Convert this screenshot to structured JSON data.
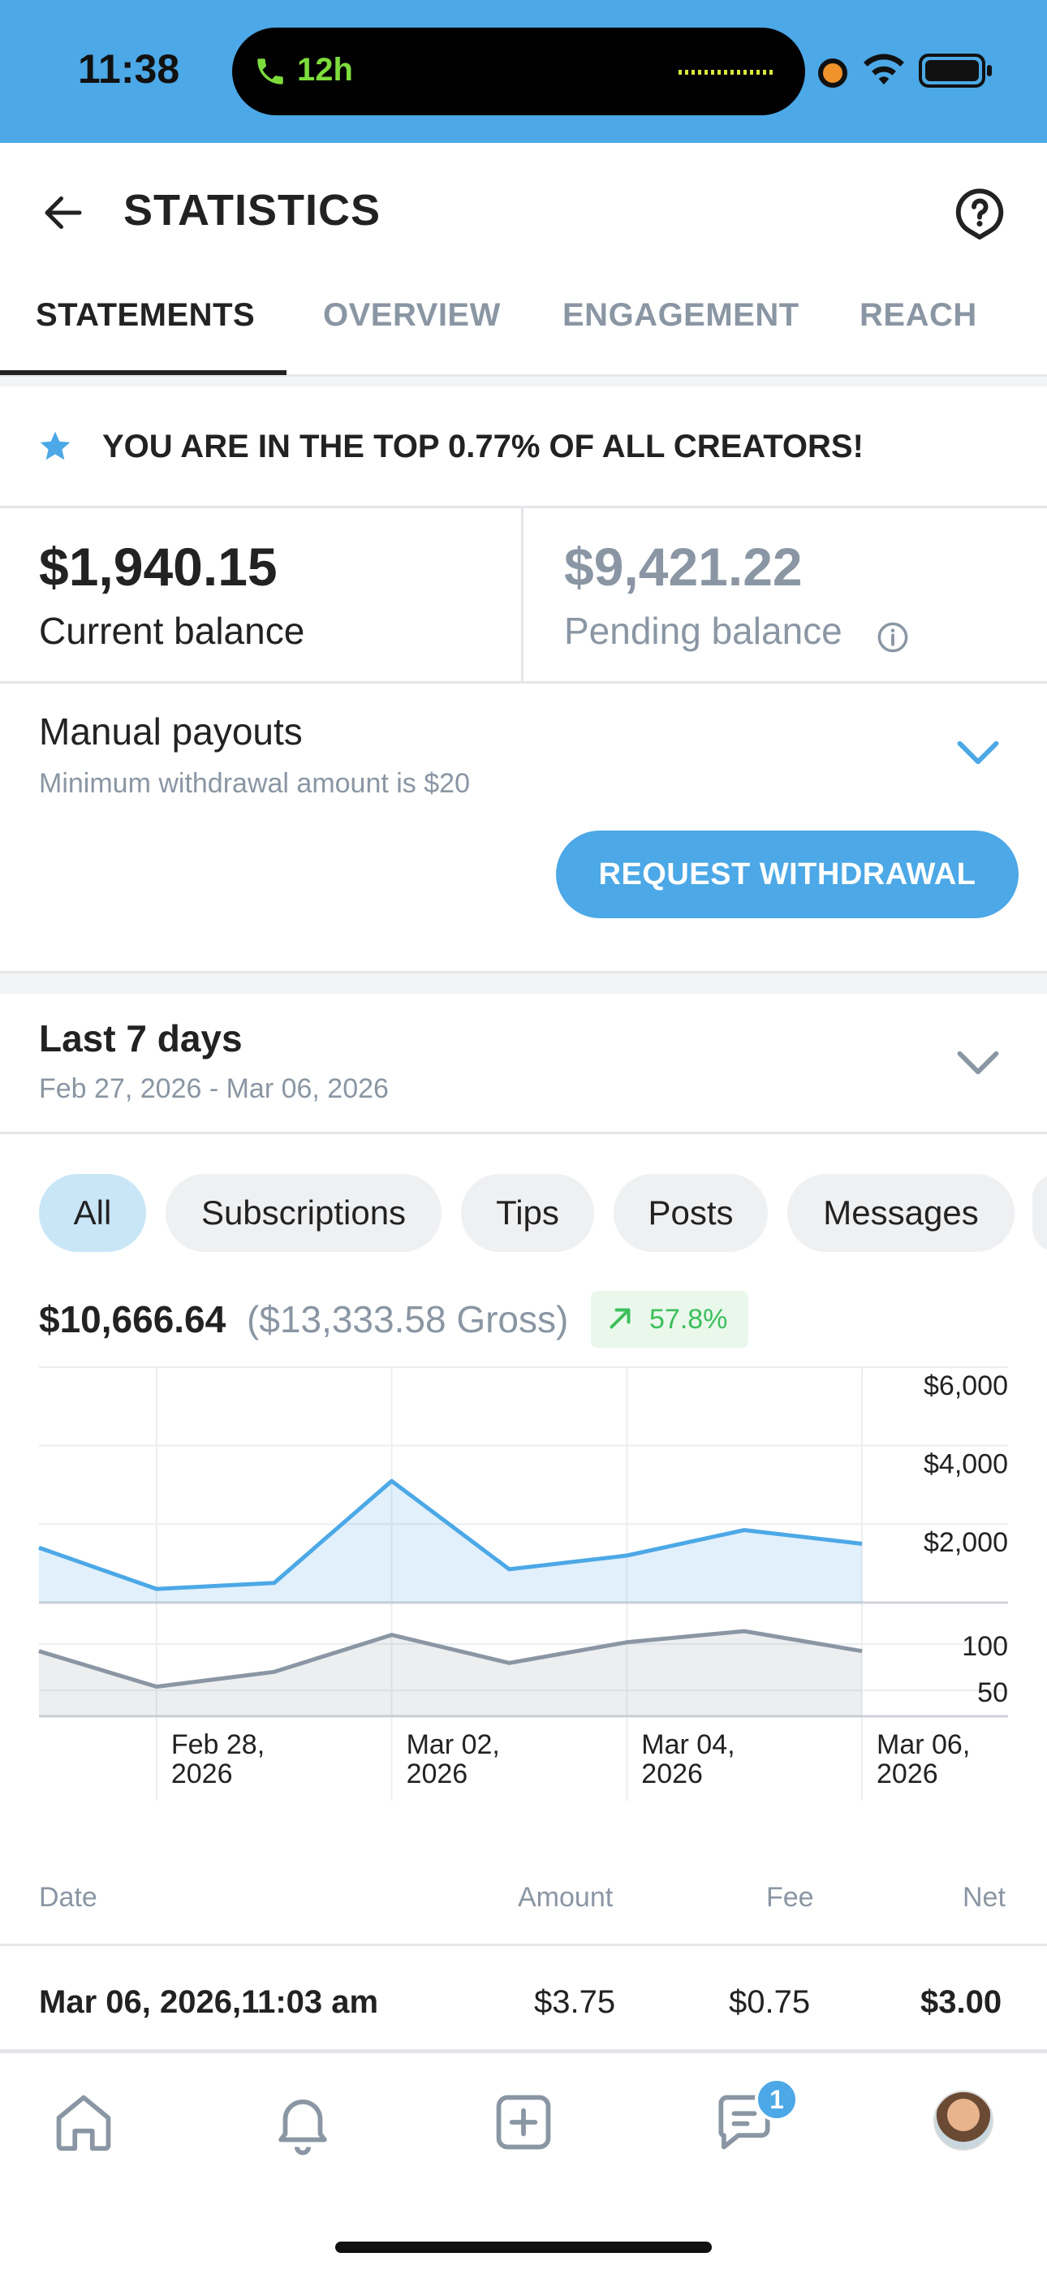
{
  "status_bar": {
    "time": "11:38",
    "call_duration": "12h"
  },
  "header": {
    "title": "STATISTICS"
  },
  "tabs": [
    {
      "label": "STATEMENTS",
      "active": true
    },
    {
      "label": "OVERVIEW",
      "active": false
    },
    {
      "label": "ENGAGEMENT",
      "active": false
    },
    {
      "label": "REACH",
      "active": false
    }
  ],
  "banner": {
    "text": "YOU ARE IN THE TOP 0.77% OF ALL CREATORS!"
  },
  "balances": {
    "current_amount": "$1,940.15",
    "current_label": "Current balance",
    "pending_amount": "$9,421.22",
    "pending_label": "Pending balance"
  },
  "payouts": {
    "title": "Manual payouts",
    "subtitle": "Minimum withdrawal amount is $20",
    "button": "REQUEST WITHDRAWAL"
  },
  "period": {
    "title": "Last 7 days",
    "range": "Feb 27, 2026 - Mar 06, 2026"
  },
  "filters": [
    {
      "label": "All",
      "active": true
    },
    {
      "label": "Subscriptions",
      "active": false
    },
    {
      "label": "Tips",
      "active": false
    },
    {
      "label": "Posts",
      "active": false
    },
    {
      "label": "Messages",
      "active": false
    }
  ],
  "totals": {
    "net": "$10,666.64",
    "gross": "($13,333.58 Gross)",
    "change": "57.8%"
  },
  "chart_data": {
    "type": "area",
    "x": [
      "Feb 27, 2026",
      "Feb 28, 2026",
      "Mar 01, 2026",
      "Mar 02, 2026",
      "Mar 03, 2026",
      "Mar 04, 2026",
      "Mar 05, 2026",
      "Mar 06, 2026"
    ],
    "x_tick_labels": [
      {
        "line1": "Feb 28,",
        "line2": "2026"
      },
      {
        "line1": "Mar 02,",
        "line2": "2026"
      },
      {
        "line1": "Mar 04,",
        "line2": "2026"
      },
      {
        "line1": "Mar 06,",
        "line2": "2026"
      }
    ],
    "panels": [
      {
        "series": [
          {
            "values": [
              1400,
              350,
              500,
              3100,
              850,
              1200,
              1850,
              1500
            ],
            "color": "#4ca8e6"
          }
        ],
        "y_ticks": [
          "$6,000",
          "$4,000",
          "$2,000"
        ],
        "ylim": [
          0,
          6000
        ]
      },
      {
        "series": [
          {
            "values": [
              88,
              40,
              60,
              110,
              72,
              100,
              115,
              88
            ],
            "color": "#8a96a3"
          }
        ],
        "y_ticks": [
          "100",
          "50"
        ],
        "ylim": [
          0,
          125
        ]
      }
    ],
    "grid": true
  },
  "table": {
    "headers": [
      "Date",
      "Amount",
      "Fee",
      "Net"
    ],
    "rows": [
      {
        "date": "Mar 06, 2026,11:03 am",
        "amount": "$3.75",
        "fee": "$0.75",
        "net": "$3.00"
      }
    ]
  },
  "bottom_nav": {
    "messages_badge": "1"
  }
}
